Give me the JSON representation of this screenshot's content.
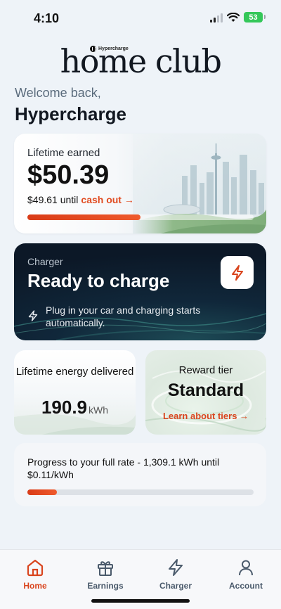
{
  "status_bar": {
    "time": "4:10",
    "battery": "53"
  },
  "logo": {
    "brand": "Hypercharge",
    "title": "home club"
  },
  "welcome": {
    "label": "Welcome back,",
    "name": "Hypercharge"
  },
  "earned": {
    "label": "Lifetime earned",
    "amount": "$50.39",
    "until_prefix": "$49.61 until",
    "cash_out": "cash out →",
    "progress": 0.5
  },
  "charger": {
    "label": "Charger",
    "title": "Ready to charge",
    "info": "Plug in your car and charging starts automatically."
  },
  "energy": {
    "label": "Lifetime energy delivered",
    "value": "190.9",
    "unit": "kWh"
  },
  "tier": {
    "label": "Reward tier",
    "value": "Standard",
    "link": "Learn about tiers →"
  },
  "rate": {
    "text": "Progress to your full rate - 1,309.1 kWh until $0.11/kWh",
    "progress": 0.13
  },
  "tabs": [
    {
      "label": "Home",
      "icon": "home-icon",
      "active": true
    },
    {
      "label": "Earnings",
      "icon": "gift-icon",
      "active": false
    },
    {
      "label": "Charger",
      "icon": "lightning-icon",
      "active": false
    },
    {
      "label": "Account",
      "icon": "user-icon",
      "active": false
    }
  ],
  "colors": {
    "accent": "#d9441d",
    "dark_card": "#10273a",
    "background": "#eef3f8"
  }
}
